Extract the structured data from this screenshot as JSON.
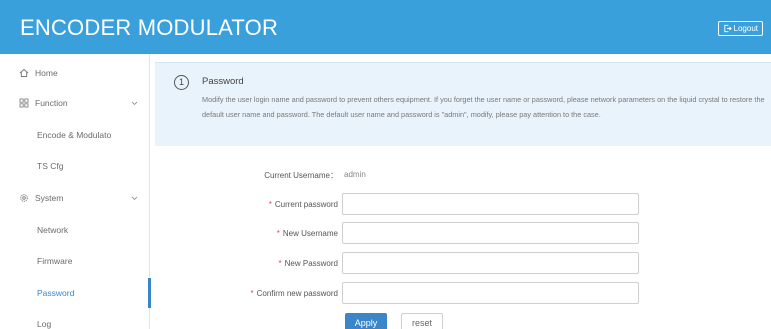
{
  "header": {
    "title": "ENCODER MODULATOR",
    "logout_label": "Logout",
    "background": "#3aa0db"
  },
  "sidebar": {
    "items": [
      {
        "label": "Home",
        "icon": "home-icon"
      },
      {
        "label": "Function",
        "icon": "grid-icon",
        "expandable": true
      },
      {
        "label": "Encode & Modulato"
      },
      {
        "label": "TS Cfg"
      },
      {
        "label": "System",
        "icon": "gear-icon",
        "expandable": true
      },
      {
        "label": "Network"
      },
      {
        "label": "Firmware"
      },
      {
        "label": "Password",
        "active": true
      },
      {
        "label": "Log"
      }
    ],
    "active_color": "#3a86c8"
  },
  "info": {
    "number": "1",
    "title": "Password",
    "text": "Modify the user login name and password to prevent others equipment. If you forget the user name or password, please network parameters on the liquid crystal to restore the default user name and password. The default user name and password is \"admin\", modify, please pay attention to the case."
  },
  "form": {
    "current_username_label": "Current Username：",
    "current_username_value": "admin",
    "current_password_label": "Current password",
    "new_username_label": "New Username",
    "new_password_label": "New Password",
    "confirm_password_label": "Confirm new password",
    "required_marker": "*",
    "apply_label": "Apply",
    "reset_label": "reset"
  }
}
